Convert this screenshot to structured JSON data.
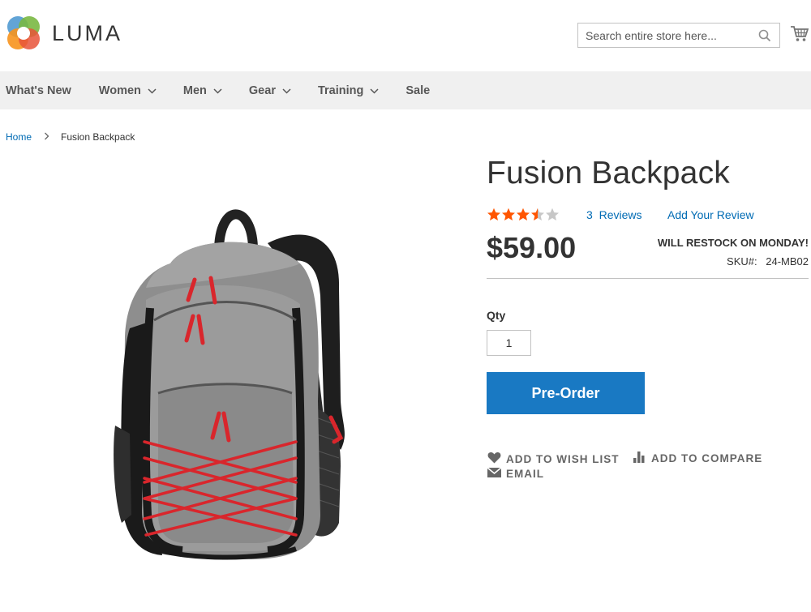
{
  "brand": {
    "name": "LUMA"
  },
  "search": {
    "placeholder": "Search entire store here..."
  },
  "nav": {
    "items": [
      {
        "label": "What's New",
        "has_dropdown": false
      },
      {
        "label": "Women",
        "has_dropdown": true
      },
      {
        "label": "Men",
        "has_dropdown": true
      },
      {
        "label": "Gear",
        "has_dropdown": true
      },
      {
        "label": "Training",
        "has_dropdown": true
      },
      {
        "label": "Sale",
        "has_dropdown": false
      }
    ]
  },
  "breadcrumb": {
    "home": "Home",
    "current": "Fusion Backpack"
  },
  "product": {
    "title": "Fusion Backpack",
    "rating_stars": 3.5,
    "rating_max": 5,
    "reviews_count": "3",
    "reviews_label": "Reviews",
    "add_review_label": "Add Your Review",
    "price": "$59.00",
    "stock_status": "WILL RESTOCK ON MONDAY!",
    "sku_label": "SKU#:",
    "sku": "24-MB02",
    "qty_label": "Qty",
    "qty_value": "1",
    "cta_label": "Pre-Order"
  },
  "actions": {
    "wishlist": "ADD TO WISH LIST",
    "compare": "ADD TO COMPARE",
    "email": "EMAIL"
  },
  "colors": {
    "link": "#006bb4",
    "button": "#1979c3",
    "star_filled": "#ff5501",
    "star_empty": "#c7c7c7",
    "nav_bg": "#f0f0f0"
  }
}
